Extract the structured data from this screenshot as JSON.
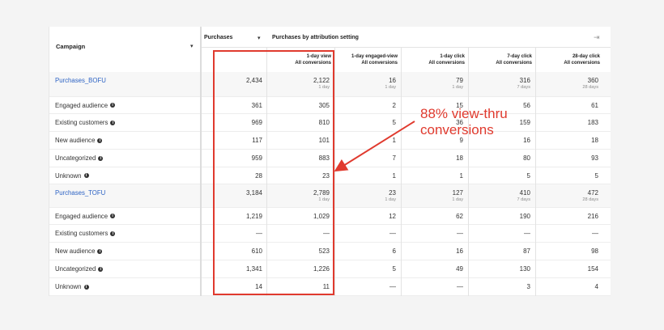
{
  "header": {
    "campaign_label": "Campaign",
    "purchases_label": "Purchases",
    "attribution_label": "Purchases by attribution setting",
    "collapse_icon": "collapse-icon",
    "dropdown_icon": "chevron-down-icon"
  },
  "columns": [
    {
      "l1": "1-day view",
      "l2": "All conversions"
    },
    {
      "l1": "1-day engaged-view",
      "l2": "All conversions"
    },
    {
      "l1": "1-day click",
      "l2": "All conversions"
    },
    {
      "l1": "7-day click",
      "l2": "All conversions"
    },
    {
      "l1": "28-day click",
      "l2": "All conversions"
    }
  ],
  "rows": [
    {
      "name": "Purchases_BOFU",
      "type": "campaign",
      "purchases": "2,434",
      "values": [
        "2,122",
        "16",
        "79",
        "316",
        "360"
      ],
      "subs": [
        "1 day",
        "1 day",
        "1 day",
        "7 days",
        "28 days"
      ]
    },
    {
      "name": "Engaged audience",
      "type": "segment",
      "purchases": "361",
      "values": [
        "305",
        "2",
        "15",
        "56",
        "61"
      ]
    },
    {
      "name": "Existing customers",
      "type": "segment",
      "purchases": "969",
      "values": [
        "810",
        "5",
        "36",
        "159",
        "183"
      ]
    },
    {
      "name": "New audience",
      "type": "segment",
      "purchases": "117",
      "values": [
        "101",
        "1",
        "9",
        "16",
        "18"
      ]
    },
    {
      "name": "Uncategorized",
      "type": "segment",
      "purchases": "959",
      "values": [
        "883",
        "7",
        "18",
        "80",
        "93"
      ]
    },
    {
      "name": "Unknown",
      "type": "segment",
      "purchases": "28",
      "values": [
        "23",
        "1",
        "1",
        "5",
        "5"
      ]
    },
    {
      "name": "Purchases_TOFU",
      "type": "campaign",
      "purchases": "3,184",
      "values": [
        "2,789",
        "23",
        "127",
        "410",
        "472"
      ],
      "subs": [
        "1 day",
        "1 day",
        "1 day",
        "7 days",
        "28 days"
      ]
    },
    {
      "name": "Engaged audience",
      "type": "segment",
      "purchases": "1,219",
      "values": [
        "1,029",
        "12",
        "62",
        "190",
        "216"
      ]
    },
    {
      "name": "Existing customers",
      "type": "segment",
      "purchases": "—",
      "values": [
        "—",
        "—",
        "—",
        "—",
        "—"
      ]
    },
    {
      "name": "New audience",
      "type": "segment",
      "purchases": "610",
      "values": [
        "523",
        "6",
        "16",
        "87",
        "98"
      ]
    },
    {
      "name": "Uncategorized",
      "type": "segment",
      "purchases": "1,341",
      "values": [
        "1,226",
        "5",
        "49",
        "130",
        "154"
      ]
    },
    {
      "name": "Unknown",
      "type": "segment",
      "purchases": "14",
      "values": [
        "11",
        "—",
        "—",
        "3",
        "4"
      ]
    }
  ],
  "annotation": {
    "line1": "88% view-thru",
    "line2": "conversions"
  },
  "colors": {
    "highlight": "#e03a2e",
    "link": "#2d63c4",
    "campaign_row_bg": "#f7f7f7"
  }
}
